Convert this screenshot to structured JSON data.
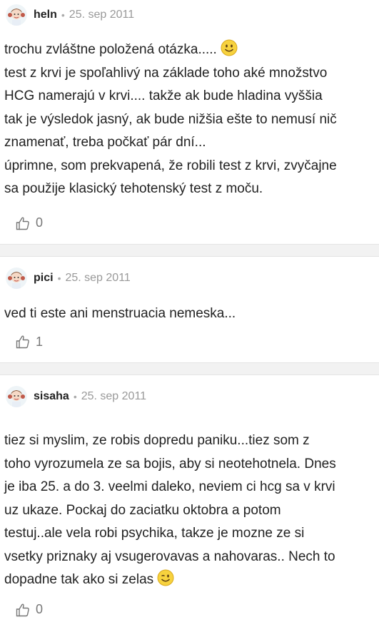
{
  "comments": [
    {
      "author": "heln",
      "date": "25. sep 2011",
      "lines": [
        "trochu zvláštne položená otázka.....",
        "test z krvi je spoľahlivý na základe toho aké množstvo",
        "HCG namerajú v krvi.... takže ak bude hladina vyššia",
        "tak je výsledok jasný, ak bude nižšia ešte to nemusí nič",
        "znamenať, treba počkať pár dní...",
        "úprimne, som prekvapená, že robili test z krvi, zvyčajne",
        "sa použije klasický tehotenský test z moču."
      ],
      "emoji": "smile-emoji",
      "likes": "0"
    },
    {
      "author": "pici",
      "date": "25. sep 2011",
      "lines": [
        "ved ti este ani menstruacia nemeska..."
      ],
      "likes": "1"
    },
    {
      "author": "sisaha",
      "date": "25. sep 2011",
      "lines": [
        "tiez si myslim, ze robis dopredu paniku...tiez som z",
        "toho vyrozumela ze sa bojis, aby si neotehotnela. Dnes",
        "je iba 25. a do 3. veelmi daleko, neviem ci hcg sa v krvi",
        "uz ukaze. Pockaj do zaciatku oktobra a potom",
        "testuj..ale vela robi psychika, takze je mozne ze si",
        "vsetky priznaky aj vsugerovavas a nahovaras.. Nech to",
        "dopadne tak ako si zelas"
      ],
      "emoji": "wink-emoji",
      "likes": "0"
    }
  ],
  "icons": {
    "avatar": "cartoon-girl-avatar",
    "like": "thumbs-up-icon"
  },
  "colors": {
    "text": "#222222",
    "meta": "#999999",
    "divider": "#f2f2f2"
  }
}
